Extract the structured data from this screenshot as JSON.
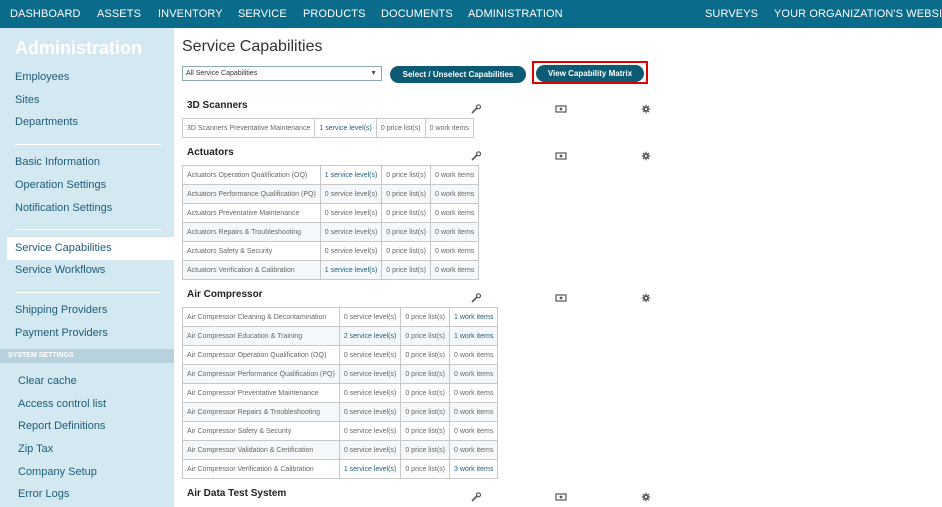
{
  "topnav": {
    "left": [
      "DASHBOARD",
      "ASSETS",
      "INVENTORY",
      "SERVICE",
      "PRODUCTS",
      "DOCUMENTS",
      "ADMINISTRATION"
    ],
    "right": [
      "SURVEYS",
      "YOUR ORGANIZATION'S WEBSITE"
    ]
  },
  "sidebar": {
    "title": "Administration",
    "group1": [
      "Employees",
      "Sites",
      "Departments"
    ],
    "group2": [
      "Basic Information",
      "Operation Settings",
      "Notification Settings"
    ],
    "group3": [
      "Service Capabilities",
      "Service Workflows"
    ],
    "group4": [
      "Shipping Providers",
      "Payment Providers"
    ],
    "system_header": "SYSTEM SETTINGS",
    "system": [
      "Clear cache",
      "Access control list",
      "Report Definitions",
      "Zip Tax",
      "Company Setup",
      "Error Logs"
    ]
  },
  "main": {
    "title": "Service Capabilities",
    "filter_value": "All Service Capabilities",
    "select_btn": "Select / Unselect Capabilities",
    "matrix_btn": "View Capability Matrix",
    "sections": [
      {
        "title": "3D Scanners",
        "rows": [
          [
            "3D Scanners Preventative Maintenance",
            "1 service level(s)",
            "0 price list(s)",
            "0 work items"
          ]
        ]
      },
      {
        "title": "Actuators",
        "rows": [
          [
            "Actuators Operation Qualification (OQ)",
            "1 service level(s)",
            "0 price list(s)",
            "0 work items"
          ],
          [
            "Actuators Performance Qualification (PQ)",
            "0 service level(s)",
            "0 price list(s)",
            "0 work items"
          ],
          [
            "Actuators Preventative Maintenance",
            "0 service level(s)",
            "0 price list(s)",
            "0 work items"
          ],
          [
            "Actuators Repairs & Troubleshooting",
            "0 service level(s)",
            "0 price list(s)",
            "0 work items"
          ],
          [
            "Actuators Safety & Security",
            "0 service level(s)",
            "0 price list(s)",
            "0 work items"
          ],
          [
            "Actuators Verification & Calibration",
            "1 service level(s)",
            "0 price list(s)",
            "0 work items"
          ]
        ]
      },
      {
        "title": "Air Compressor",
        "rows": [
          [
            "Air Compressor Cleaning & Decontamination",
            "0 service level(s)",
            "0 price list(s)",
            "1 work items"
          ],
          [
            "Air Compressor Education & Training",
            "2 service level(s)",
            "0 price list(s)",
            "1 work items"
          ],
          [
            "Air Compressor Operation Qualification (OQ)",
            "0 service level(s)",
            "0 price list(s)",
            "0 work items"
          ],
          [
            "Air Compressor Performance Qualification (PQ)",
            "0 service level(s)",
            "0 price list(s)",
            "0 work items"
          ],
          [
            "Air Compressor Preventative Maintenance",
            "0 service level(s)",
            "0 price list(s)",
            "0 work items"
          ],
          [
            "Air Compressor Repairs & Troubleshooting",
            "0 service level(s)",
            "0 price list(s)",
            "0 work items"
          ],
          [
            "Air Compressor Safety & Security",
            "0 service level(s)",
            "0 price list(s)",
            "0 work items"
          ],
          [
            "Air Compressor Validation & Certification",
            "0 service level(s)",
            "0 price list(s)",
            "0 work items"
          ],
          [
            "Air Compressor Verification & Calibration",
            "1 service level(s)",
            "0 price list(s)",
            "3 work items"
          ]
        ]
      },
      {
        "title": "Air Data Test System",
        "rows": []
      }
    ]
  },
  "colors": {
    "nav": "#0a6b8a",
    "sidebar": "#d3e8f0",
    "button": "#0a5b73",
    "highlight": "#e00000"
  }
}
